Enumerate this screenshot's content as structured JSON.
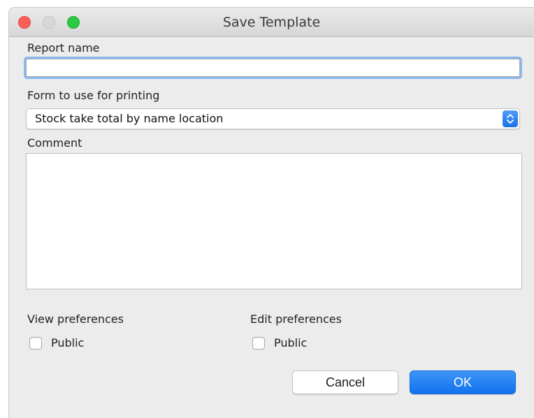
{
  "window": {
    "title": "Save Template"
  },
  "report_name": {
    "label": "Report name",
    "value": ""
  },
  "form_for_printing": {
    "label": "Form to use for printing",
    "selected": "Stock take total by name location"
  },
  "comment": {
    "label": "Comment",
    "value": ""
  },
  "view_preferences": {
    "label": "View preferences",
    "public_label": "Public",
    "public_checked": false
  },
  "edit_preferences": {
    "label": "Edit preferences",
    "public_label": "Public",
    "public_checked": false
  },
  "buttons": {
    "cancel": "Cancel",
    "ok": "OK"
  },
  "colors": {
    "accent": "#1172ee",
    "close": "#fc5f57",
    "maximize": "#29c940"
  }
}
